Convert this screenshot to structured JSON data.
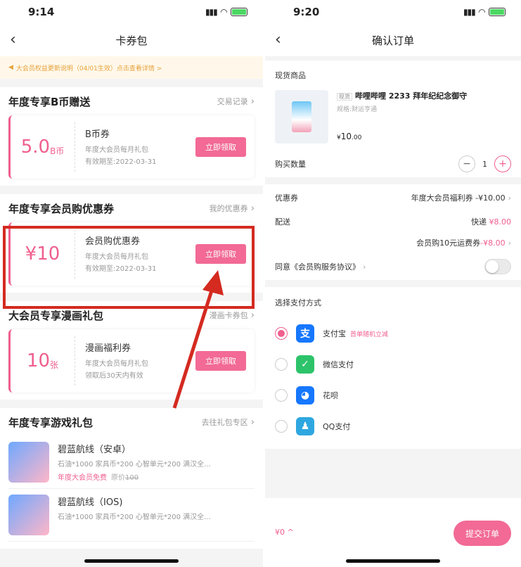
{
  "left": {
    "status": {
      "time": "9:14"
    },
    "nav": {
      "title": "卡券包"
    },
    "notice": "大会员权益更新说明（04/01生效）点击查看详情 >",
    "sections": {
      "bcoin": {
        "title": "年度专享B币赠送",
        "link": "交易记录",
        "coupon": {
          "amount": "5.0",
          "unit": "B币",
          "name": "B币券",
          "desc": "年度大会员每月礼包",
          "expiry": "有效期至:2022-03-31",
          "button": "立即领取"
        }
      },
      "shop": {
        "title": "年度专享会员购优惠券",
        "link": "我的优惠券",
        "coupon": {
          "amount": "¥10",
          "unit": "",
          "name": "会员购优惠券",
          "desc": "年度大会员每月礼包",
          "expiry": "有效期至:2022-03-31",
          "button": "立即领取"
        }
      },
      "comic": {
        "title": "大会员专享漫画礼包",
        "link": "漫画卡券包",
        "coupon": {
          "amount": "10",
          "unit": "张",
          "name": "漫画福利券",
          "desc": "年度大会员每月礼包",
          "expiry": "领取后30天内有效",
          "button": "立即领取"
        }
      },
      "games": {
        "title": "年度专享游戏礼包",
        "link": "去往礼包专区",
        "items": [
          {
            "name": "碧蓝航线（安卓）",
            "desc": "石油*1000 家具币*200 心智单元*200 满汉全...",
            "free": "年度大会员免费",
            "orig_label": "原价",
            "orig": "100"
          },
          {
            "name": "碧蓝航线（IOS)",
            "desc": "石油*1000 家具币*200 心智单元*200 满汉全...",
            "free": "",
            "orig_label": "",
            "orig": ""
          }
        ]
      }
    }
  },
  "right": {
    "status": {
      "time": "9:20"
    },
    "nav": {
      "title": "确认订单"
    },
    "goods_section": "现货商品",
    "goods": {
      "tag": "现货",
      "title": "哔哩哔哩 2233 拜年纪纪念御守",
      "spec": "规格:财运亨通",
      "price_symbol": "¥",
      "price": "10",
      "price_dec": ".00"
    },
    "qty": {
      "label": "购买数量",
      "value": "1",
      "minus": "−",
      "plus": "+"
    },
    "coupon": {
      "label": "优惠券",
      "value": "年度大会员福利券 -¥10.00"
    },
    "shipping": {
      "label": "配送",
      "method": "快递",
      "fee": "¥8.00",
      "coupon_label": "会员购10元运费券",
      "coupon_value": "-¥8.00"
    },
    "agree": {
      "label": "同意《会员购服务协议》"
    },
    "payment": {
      "title": "选择支付方式",
      "methods": [
        {
          "name": "支付宝",
          "promo": "首单随机立减",
          "icon": "支",
          "color": "#1677ff",
          "selected": true
        },
        {
          "name": "微信支付",
          "promo": "",
          "icon": "✓",
          "color": "#2dc36a",
          "selected": false
        },
        {
          "name": "花呗",
          "promo": "",
          "icon": "◕",
          "color": "#1677ff",
          "selected": false
        },
        {
          "name": "QQ支付",
          "promo": "",
          "icon": "♟",
          "color": "#2ea7e0",
          "selected": false
        }
      ]
    },
    "footer": {
      "total": "¥0 ^",
      "submit": "提交订单"
    }
  }
}
